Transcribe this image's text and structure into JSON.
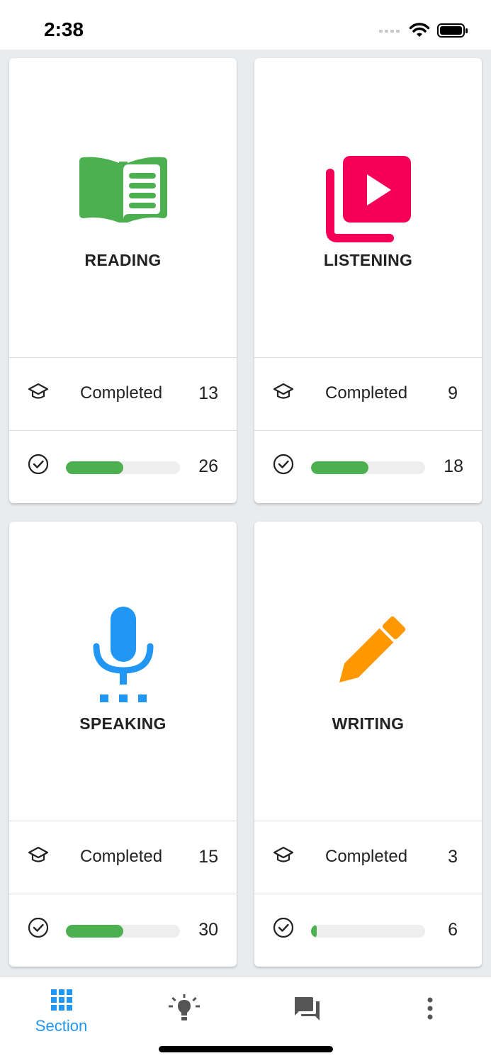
{
  "status_bar": {
    "time": "2:38"
  },
  "colors": {
    "reading": "#4caf50",
    "listening": "#f50057",
    "speaking": "#2196f3",
    "writing": "#ff9800",
    "progress": "#4caf50",
    "tab_active": "#2196f3",
    "tab_inactive": "#555555"
  },
  "sections": [
    {
      "title": "READING",
      "icon": "book-icon",
      "completed_label": "Completed",
      "completed_count": "13",
      "total": "26",
      "progress": 0.5
    },
    {
      "title": "LISTENING",
      "icon": "video-library-icon",
      "completed_label": "Completed",
      "completed_count": "9",
      "total": "18",
      "progress": 0.5
    },
    {
      "title": "SPEAKING",
      "icon": "microphone-icon",
      "completed_label": "Completed",
      "completed_count": "15",
      "total": "30",
      "progress": 0.5
    },
    {
      "title": "WRITING",
      "icon": "pencil-icon",
      "completed_label": "Completed",
      "completed_count": "3",
      "total": "6",
      "progress": 0.05
    }
  ],
  "tab_bar": {
    "tabs": [
      {
        "label": "Section",
        "icon": "grid-icon",
        "active": true
      },
      {
        "label": "",
        "icon": "lightbulb-icon",
        "active": false
      },
      {
        "label": "",
        "icon": "chat-icon",
        "active": false
      },
      {
        "label": "",
        "icon": "more-vert-icon",
        "active": false
      }
    ]
  }
}
